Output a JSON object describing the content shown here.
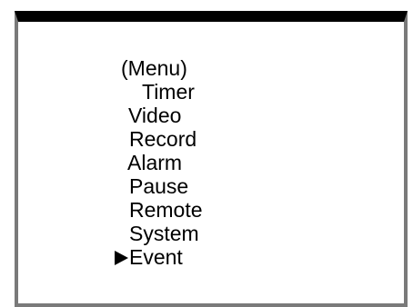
{
  "menu": {
    "title": "(Menu)",
    "items": [
      {
        "label": "Timer"
      },
      {
        "label": "Video"
      },
      {
        "label": "Record"
      },
      {
        "label": "Alarm"
      },
      {
        "label": "Pause"
      },
      {
        "label": "Remote"
      },
      {
        "label": "System"
      },
      {
        "label": "Event",
        "selected": true
      }
    ],
    "cursor_icon": "pointer-arrow-icon"
  }
}
